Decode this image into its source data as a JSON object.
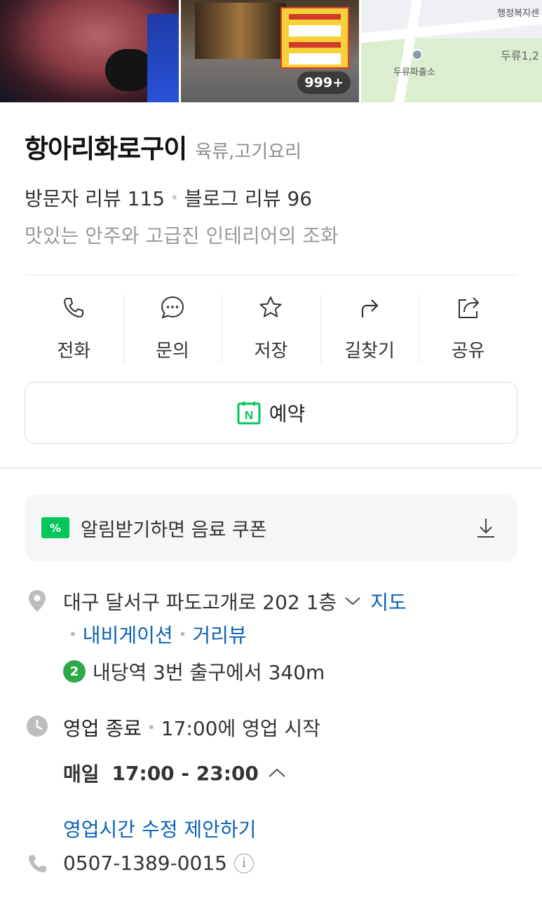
{
  "photos": {
    "count_badge": "999+",
    "map_labels": [
      "행정복지센",
      "두류1,2",
      "두류파출소"
    ]
  },
  "place": {
    "name": "항아리화로구이",
    "category": "육류,고기요리",
    "visitor_reviews": "방문자 리뷰 115",
    "blog_reviews": "블로그 리뷰 96",
    "description": "맛있는 안주와 고급진 인테리어의 조화"
  },
  "actions": [
    {
      "label": "전화",
      "icon": "phone-icon"
    },
    {
      "label": "문의",
      "icon": "chat-icon"
    },
    {
      "label": "저장",
      "icon": "star-icon"
    },
    {
      "label": "길찾기",
      "icon": "directions-icon"
    },
    {
      "label": "공유",
      "icon": "share-icon"
    }
  ],
  "reserve": {
    "label": "예약",
    "icon_letter": "N"
  },
  "coupon": {
    "label": "알림받기하면 음료 쿠폰",
    "icon_text": "%"
  },
  "address": {
    "text": "대구 달서구 파도고개로 202 1층",
    "map_link": "지도",
    "navigation_link": "내비게이션",
    "street_view_link": "거리뷰",
    "subway_line": "2",
    "subway_text": "내당역 3번 출구에서 340m"
  },
  "hours": {
    "status": "영업 종료",
    "next": "17:00에 영업 시작",
    "day": "매일",
    "time": "17:00 - 23:00",
    "edit_link": "영업시간 수정 제안하기"
  },
  "phone": {
    "number": "0507-1389-0015",
    "info_symbol": "i"
  },
  "colors": {
    "brand_green": "#03c75a",
    "link_blue": "#0a62b8",
    "subway_line2": "#2fa84a"
  }
}
